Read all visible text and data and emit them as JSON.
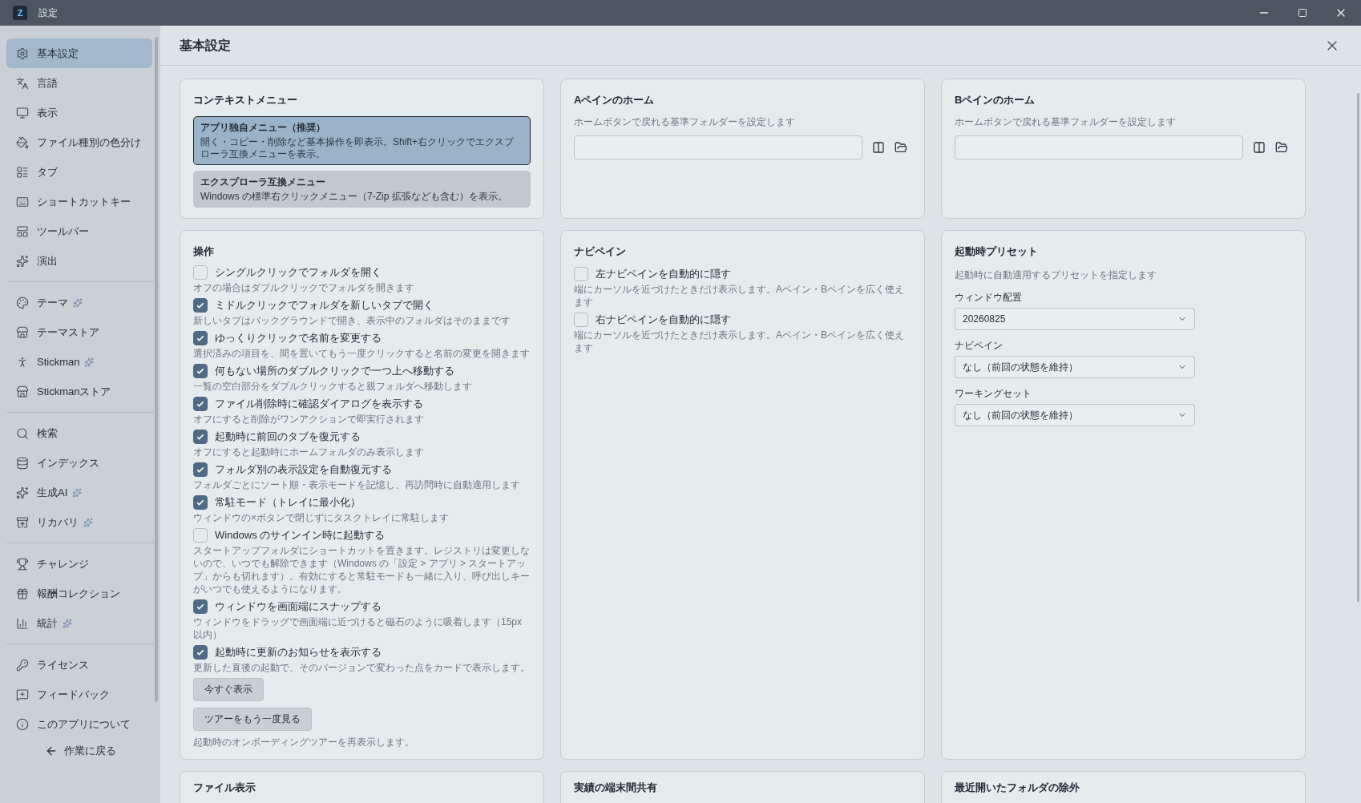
{
  "window": {
    "logo": "Z",
    "title": "設定"
  },
  "sidebar": {
    "groups": [
      [
        {
          "label": "基本設定",
          "selected": true,
          "new": false
        },
        {
          "label": "言語",
          "selected": false,
          "new": false
        },
        {
          "label": "表示",
          "selected": false,
          "new": false
        },
        {
          "label": "ファイル種別の色分け",
          "selected": false,
          "new": false
        },
        {
          "label": "タブ",
          "selected": false,
          "new": false
        },
        {
          "label": "ショートカットキー",
          "selected": false,
          "new": false
        },
        {
          "label": "ツールバー",
          "selected": false,
          "new": false
        },
        {
          "label": "演出",
          "selected": false,
          "new": false
        }
      ],
      [
        {
          "label": "テーマ",
          "selected": false,
          "new": true
        },
        {
          "label": "テーマストア",
          "selected": false,
          "new": false
        },
        {
          "label": "Stickman",
          "selected": false,
          "new": true
        },
        {
          "label": "Stickmanストア",
          "selected": false,
          "new": false
        }
      ],
      [
        {
          "label": "検索",
          "selected": false,
          "new": false
        },
        {
          "label": "インデックス",
          "selected": false,
          "new": false
        },
        {
          "label": "生成AI",
          "selected": false,
          "new": true
        },
        {
          "label": "リカバリ",
          "selected": false,
          "new": true
        }
      ],
      [
        {
          "label": "チャレンジ",
          "selected": false,
          "new": false
        },
        {
          "label": "報酬コレクション",
          "selected": false,
          "new": false
        },
        {
          "label": "統計",
          "selected": false,
          "new": true
        }
      ],
      [
        {
          "label": "ライセンス",
          "selected": false,
          "new": false
        },
        {
          "label": "フィードバック",
          "selected": false,
          "new": false
        },
        {
          "label": "このアプリについて",
          "selected": false,
          "new": false
        }
      ]
    ],
    "back": "作業に戻る"
  },
  "page": {
    "title": "基本設定"
  },
  "context_menu": {
    "title": "コンテキストメニュー",
    "options": [
      {
        "title": "アプリ独自メニュー（推奨）",
        "description": "開く・コピー・削除など基本操作を即表示。Shift+右クリックでエクスプローラ互換メニューを表示。",
        "selected": true
      },
      {
        "title": "エクスプローラ互換メニュー",
        "description": "Windows の標準右クリックメニュー（7-Zip 拡張なども含む）を表示。",
        "selected": false
      }
    ]
  },
  "a_pane_home": {
    "title": "Aペインのホーム",
    "description": "ホームボタンで戻れる基準フォルダーを設定します"
  },
  "b_pane_home": {
    "title": "Bペインのホーム",
    "description": "ホームボタンで戻れる基準フォルダーを設定します"
  },
  "operation": {
    "title": "操作",
    "items": [
      {
        "label": "シングルクリックでフォルダを開く",
        "description": "オフの場合はダブルクリックでフォルダを開きます",
        "checked": false
      },
      {
        "label": "ミドルクリックでフォルダを新しいタブで開く",
        "description": "新しいタブはバックグラウンドで開き、表示中のフォルダはそのままです",
        "checked": true
      },
      {
        "label": "ゆっくりクリックで名前を変更する",
        "description": "選択済みの項目を、間を置いてもう一度クリックすると名前の変更を開きます",
        "checked": true
      },
      {
        "label": "何もない場所のダブルクリックで一つ上へ移動する",
        "description": "一覧の空白部分をダブルクリックすると親フォルダへ移動します",
        "checked": true
      },
      {
        "label": "ファイル削除時に確認ダイアログを表示する",
        "description": "オフにすると削除がワンアクションで即実行されます",
        "checked": true
      },
      {
        "label": "起動時に前回のタブを復元する",
        "description": "オフにすると起動時にホームフォルダのみ表示します",
        "checked": true
      },
      {
        "label": "フォルダ別の表示設定を自動復元する",
        "description": "フォルダごとにソート順・表示モードを記憶し、再訪問時に自動適用します",
        "checked": true
      },
      {
        "label": "常駐モード（トレイに最小化）",
        "description": "ウィンドウの×ボタンで閉じずにタスクトレイに常駐します",
        "checked": true
      },
      {
        "label": "Windows のサインイン時に起動する",
        "description": "スタートアップフォルダにショートカットを置きます。レジストリは変更しないので、いつでも解除できます（Windows の「設定 > アプリ > スタートアップ」からも切れます）。有効にすると常駐モードも一緒に入り、呼び出しキーがいつでも使えるようになります。",
        "checked": false
      },
      {
        "label": "ウィンドウを画面端にスナップする",
        "description": "ウィンドウをドラッグで画面端に近づけると磁石のように吸着します（15px 以内）",
        "checked": true
      },
      {
        "label": "起動時に更新のお知らせを表示する",
        "description": "更新した直後の起動で、そのバージョンで変わった点をカードで表示します。",
        "checked": true
      }
    ],
    "show_now_button": "今すぐ表示",
    "tour_button": "ツアーをもう一度見る",
    "tour_note": "起動時のオンボーディングツアーを再表示します。"
  },
  "nav_pane": {
    "title": "ナビペイン",
    "items": [
      {
        "label": "左ナビペインを自動的に隠す",
        "description": "端にカーソルを近づけたときだけ表示します。Aペイン・Bペインを広く使えます",
        "checked": false
      },
      {
        "label": "右ナビペインを自動的に隠す",
        "description": "端にカーソルを近づけたときだけ表示します。Aペイン・Bペインを広く使えます",
        "checked": false
      }
    ]
  },
  "startup_preset": {
    "title": "起動時プリセット",
    "description": "起動時に自動適用するプリセットを指定します",
    "fields": [
      {
        "label": "ウィンドウ配置",
        "value": "20260825"
      },
      {
        "label": "ナビペイン",
        "value": "なし（前回の状態を維持）"
      },
      {
        "label": "ワーキングセット",
        "value": "なし（前回の状態を維持）"
      }
    ]
  },
  "lower_cards": [
    {
      "title": "ファイル表示"
    },
    {
      "title": "実績の端末間共有"
    },
    {
      "title": "最近開いたフォルダの除外"
    }
  ]
}
